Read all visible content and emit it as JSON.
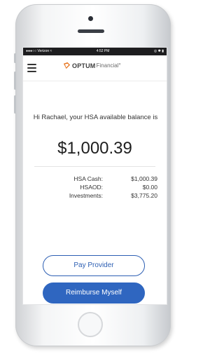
{
  "status_bar": {
    "carrier": "●●●○○ Verizon ≈",
    "time": "4:52 PM",
    "indicators": "◎ ✱ ▮"
  },
  "header": {
    "menu_icon": "hamburger-menu-icon",
    "logo_bold": "OPTUM",
    "logo_light": "Financial°",
    "brand_color": "#e87722"
  },
  "summary": {
    "greeting": "Hi Rachael, your HSA available balance is",
    "balance": "$1,000.39"
  },
  "details": [
    {
      "label": "HSA Cash:",
      "value": "$1,000.39"
    },
    {
      "label": "HSAOD:",
      "value": "$0.00"
    },
    {
      "label": "Investments:",
      "value": "$3,775.20"
    }
  ],
  "actions": {
    "pay_provider": "Pay Provider",
    "reimburse_myself": "Reimburse Myself",
    "accent_color": "#2f66c0"
  }
}
